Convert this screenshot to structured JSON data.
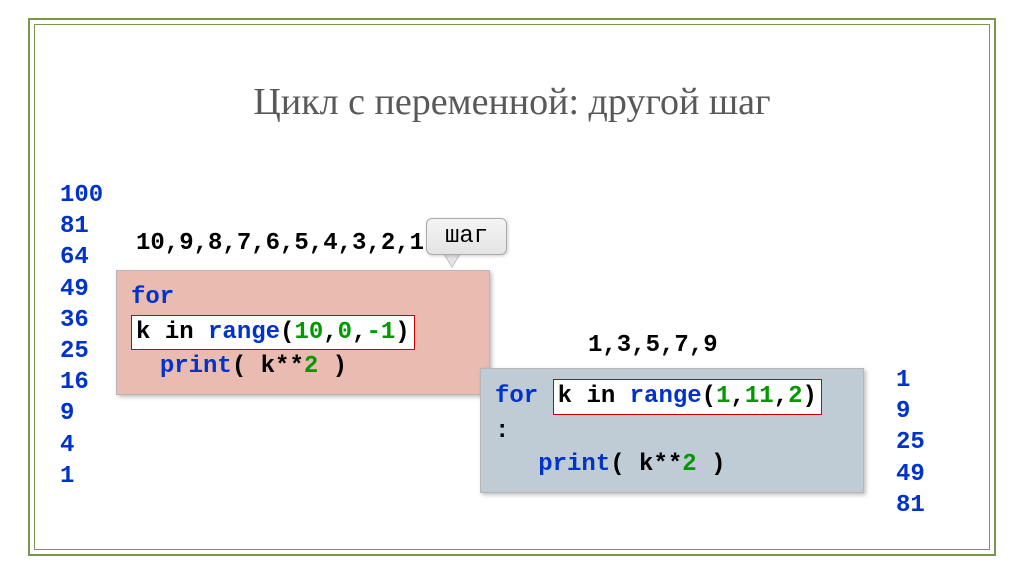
{
  "title": "Цикл с переменной: другой шаг",
  "left": {
    "output": [
      "100",
      "81",
      "64",
      "49",
      "36",
      "25",
      "16",
      "9",
      "4",
      "1"
    ],
    "sequence": "10,9,8,7,6,5,4,3,2,1",
    "code": {
      "for": "for",
      "var": "k",
      "in": "in",
      "range": "range",
      "open": "(",
      "a1": "10",
      "c1": ",",
      "a2": "0",
      "c2": ",",
      "a3": "-1",
      "close": ")",
      "print": "print",
      "popen": "(",
      "expr_k": "k",
      "expr_op": "**",
      "expr_n": "2",
      "pclose": ")"
    }
  },
  "right": {
    "sequence": "1,3,5,7,9",
    "output": [
      "1",
      "9",
      "25",
      "49",
      "81"
    ],
    "code": {
      "for": "for",
      "var": "k",
      "in": "in",
      "range": "range",
      "open": "(",
      "a1": "1",
      "c1": ",",
      "a2": "11",
      "c2": ",",
      "a3": "2",
      "close": ")",
      "colon": ":",
      "print": "print",
      "popen": "(",
      "expr_k": "k",
      "expr_op": "**",
      "expr_n": "2",
      "pclose": ")"
    }
  },
  "tag": "шаг"
}
